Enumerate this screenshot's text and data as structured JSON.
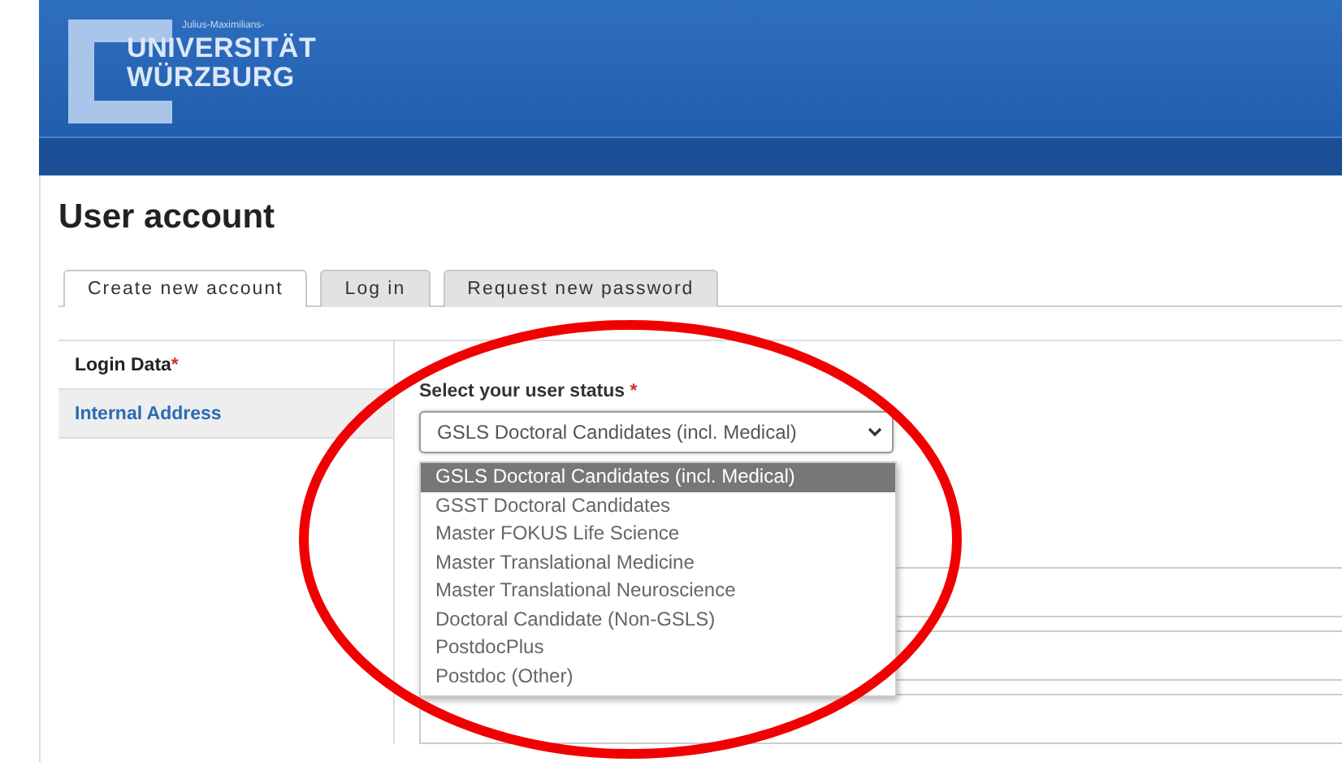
{
  "header": {
    "logo": {
      "tagline": "Julius-Maximilians-",
      "line_1": "UNIVERSITÄT",
      "line_2": "WÜRZBURG"
    }
  },
  "page_title": "User account",
  "tabs": [
    {
      "label": "Create new account",
      "selected": true
    },
    {
      "label": "Log in",
      "selected": false
    },
    {
      "label": "Request new password",
      "selected": false
    }
  ],
  "sections": [
    {
      "label": "Login Data",
      "required_mark": "*",
      "selected": true
    },
    {
      "label": "Internal Address",
      "selected": false
    }
  ],
  "user_status": {
    "label": "Select your user status",
    "required_mark": "*",
    "value": "GSLS Doctoral Candidates (incl. Medical)",
    "expanded": true,
    "options": [
      {
        "label": "GSLS Doctoral Candidates (incl. Medical)",
        "selected": true
      },
      {
        "label": "GSST Doctoral Candidates",
        "selected": false
      },
      {
        "label": "Master FOKUS Life Science",
        "selected": false
      },
      {
        "label": "Master Translational Medicine",
        "selected": false
      },
      {
        "label": "Master Translational Neuroscience",
        "selected": false
      },
      {
        "label": "Doctoral Candidate (Non-GSLS)",
        "selected": false
      },
      {
        "label": "PostdocPlus",
        "selected": false
      },
      {
        "label": "Postdoc (Other)",
        "selected": false
      }
    ]
  },
  "annotation": {
    "kind": "ellipse"
  }
}
